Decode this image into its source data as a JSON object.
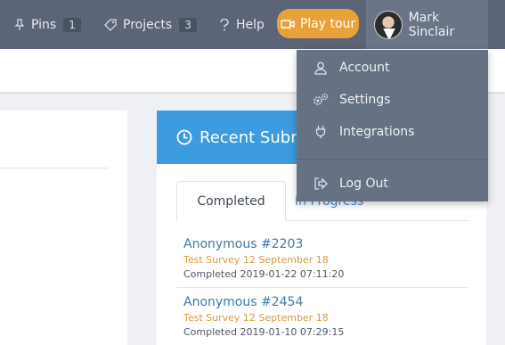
{
  "nav": {
    "pins": {
      "label": "Pins",
      "count": "1"
    },
    "projects": {
      "label": "Projects",
      "count": "3"
    },
    "help": {
      "label": "Help"
    },
    "play_tour": {
      "label": "Play tour"
    },
    "user": {
      "name": "Mark Sinclair"
    }
  },
  "user_menu": {
    "items": [
      {
        "label": "Account",
        "icon": "user-icon"
      },
      {
        "label": "Settings",
        "icon": "gears-icon"
      },
      {
        "label": "Integrations",
        "icon": "plug-icon"
      },
      {
        "label": "Log Out",
        "icon": "logout-icon"
      }
    ]
  },
  "recent": {
    "title": "Recent Subm",
    "tabs": [
      {
        "label": "Completed"
      },
      {
        "label": "In Progress"
      }
    ],
    "entries": [
      {
        "name": "Anonymous #2203",
        "survey": "Test Survey 12 September 18",
        "status": "Completed 2019-01-22 07:11:20"
      },
      {
        "name": "Anonymous #2454",
        "survey": "Test Survey 12 September 18",
        "status": "Completed 2019-01-10 07:29:15"
      }
    ]
  },
  "colors": {
    "topbar": "#5b6577",
    "accent_blue": "#3d9bde",
    "play_orange": "#e9a23b",
    "survey_orange": "#d69a42"
  }
}
